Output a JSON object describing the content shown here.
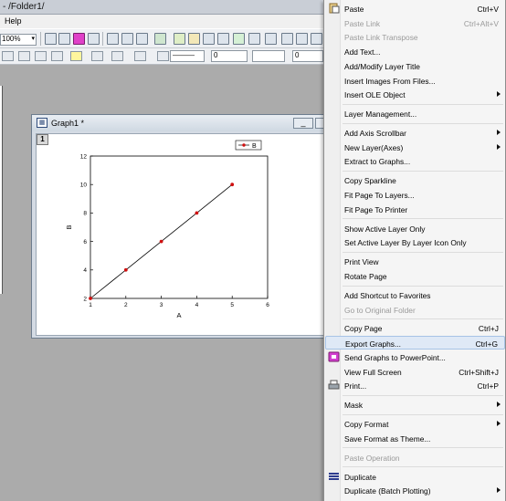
{
  "window": {
    "title": "- /Folder1/"
  },
  "menubar": {
    "help": "Help"
  },
  "toolbar": {
    "zoom": "100%"
  },
  "format_bar": {
    "line_width": "0",
    "size": "0"
  },
  "graph_window": {
    "title": "Graph1 *",
    "layer_tab": "1"
  },
  "chart_data": {
    "type": "line",
    "x": [
      1,
      2,
      3,
      4,
      5
    ],
    "series": [
      {
        "name": "B",
        "values": [
          2,
          4,
          6,
          8,
          10
        ]
      }
    ],
    "xlabel": "A",
    "ylabel": "B",
    "xlim": [
      1,
      6
    ],
    "ylim": [
      2,
      12
    ],
    "xticks": [
      "1",
      "2",
      "3",
      "4",
      "5",
      "6"
    ],
    "yticks": [
      "2",
      "4",
      "6",
      "8",
      "10",
      "12"
    ],
    "legend": "top-right",
    "line_color": "#000000",
    "marker_color": "#d01010"
  },
  "context_menu": {
    "items": [
      {
        "label": "Paste",
        "shortcut": "Ctrl+V",
        "disabled": false,
        "icon": "paste-icon"
      },
      {
        "label": "Paste Link",
        "shortcut": "Ctrl+Alt+V",
        "disabled": true
      },
      {
        "label": "Paste Link Transpose",
        "shortcut": "",
        "disabled": true
      },
      {
        "label": "Add Text...",
        "shortcut": "",
        "disabled": false
      },
      {
        "label": "Add/Modify Layer Title",
        "shortcut": "",
        "disabled": false
      },
      {
        "label": "Insert Images From Files...",
        "shortcut": "",
        "disabled": false
      },
      {
        "label": "Insert OLE Object",
        "shortcut": "",
        "disabled": false,
        "submenu": true
      },
      {
        "sep": true
      },
      {
        "label": "Layer Management...",
        "shortcut": "",
        "disabled": false
      },
      {
        "sep": true
      },
      {
        "label": "Add Axis Scrollbar",
        "shortcut": "",
        "disabled": false,
        "submenu": true
      },
      {
        "label": "New Layer(Axes)",
        "shortcut": "",
        "disabled": false,
        "submenu": true
      },
      {
        "label": "Extract to Graphs...",
        "shortcut": "",
        "disabled": false
      },
      {
        "sep": true
      },
      {
        "label": "Copy Sparkline",
        "shortcut": "",
        "disabled": false
      },
      {
        "label": "Fit Page To Layers...",
        "shortcut": "",
        "disabled": false
      },
      {
        "label": "Fit Page To Printer",
        "shortcut": "",
        "disabled": false
      },
      {
        "sep": true
      },
      {
        "label": "Show Active Layer Only",
        "shortcut": "",
        "disabled": false
      },
      {
        "label": "Set Active Layer By Layer Icon Only",
        "shortcut": "",
        "disabled": false
      },
      {
        "sep": true
      },
      {
        "label": "Print View",
        "shortcut": "",
        "disabled": false
      },
      {
        "label": "Rotate Page",
        "shortcut": "",
        "disabled": false
      },
      {
        "sep": true
      },
      {
        "label": "Add Shortcut to Favorites",
        "shortcut": "",
        "disabled": false
      },
      {
        "label": "Go to Original Folder",
        "shortcut": "",
        "disabled": true
      },
      {
        "sep": true
      },
      {
        "label": "Copy Page",
        "shortcut": "Ctrl+J",
        "disabled": false
      },
      {
        "label": "Export Graphs...",
        "shortcut": "Ctrl+G",
        "disabled": false,
        "highlighted": true
      },
      {
        "label": "Send Graphs to PowerPoint...",
        "shortcut": "",
        "disabled": false,
        "icon": "powerpoint-icon"
      },
      {
        "label": "View Full Screen",
        "shortcut": "Ctrl+Shift+J",
        "disabled": false
      },
      {
        "label": "Print...",
        "shortcut": "Ctrl+P",
        "disabled": false,
        "icon": "printer-icon"
      },
      {
        "sep": true
      },
      {
        "label": "Mask",
        "shortcut": "",
        "disabled": false,
        "submenu": true
      },
      {
        "sep": true
      },
      {
        "label": "Copy Format",
        "shortcut": "",
        "disabled": false,
        "submenu": true
      },
      {
        "label": "Save Format as Theme...",
        "shortcut": "",
        "disabled": false
      },
      {
        "sep": true
      },
      {
        "label": "Paste Operation",
        "shortcut": "",
        "disabled": true
      },
      {
        "sep": true
      },
      {
        "label": "Duplicate",
        "shortcut": "",
        "disabled": false,
        "icon": "duplicate-icon"
      },
      {
        "label": "Duplicate (Batch Plotting)",
        "shortcut": "",
        "disabled": false,
        "submenu": true
      }
    ]
  }
}
